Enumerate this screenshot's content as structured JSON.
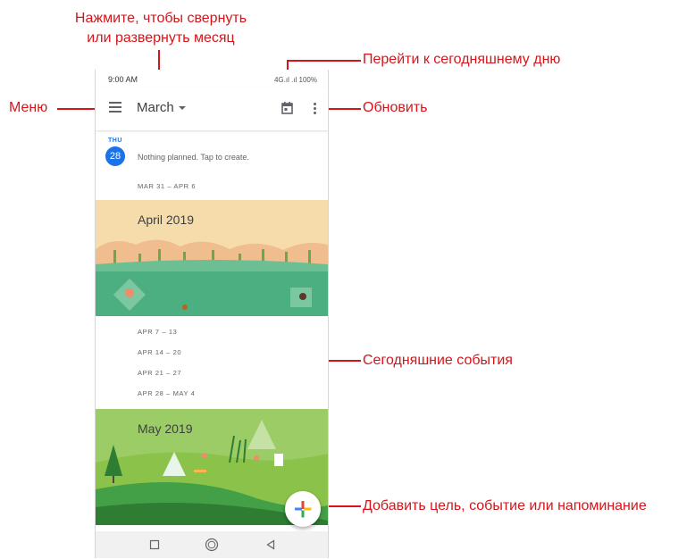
{
  "annotations": {
    "collapse_line1": "Нажмите, чтобы свернуть",
    "collapse_line2": "или развернуть месяц",
    "menu": "Меню",
    "today": "Перейти к сегодняшнему дню",
    "refresh": "Обновить",
    "todays_events": "Сегодняшние события",
    "add": "Добавить цель, событие или напоминание"
  },
  "status_bar": {
    "time": "9:00 AM",
    "indicators": "4G.ıl .ıl 100%"
  },
  "app_bar": {
    "month": "March"
  },
  "agenda": {
    "day_abbr": "THU",
    "day_number": "28",
    "empty_text": "Nothing planned. Tap to create.",
    "week_1": "MAR 31 – APR 6",
    "april_banner": "April 2019",
    "weeks": [
      "APR 7 – 13",
      "APR 14 – 20",
      "APR 21 – 27",
      "APR 28 – MAY 4"
    ],
    "may_banner": "May 2019"
  },
  "colors": {
    "accent": "#1a73e8",
    "annotation": "#d7141a"
  }
}
